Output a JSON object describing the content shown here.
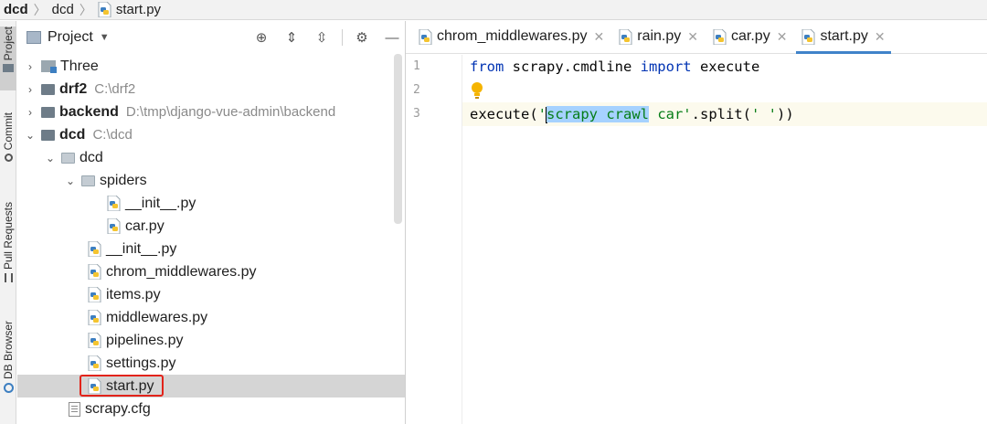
{
  "breadcrumb": {
    "items": [
      "dcd",
      "dcd",
      "start.py"
    ]
  },
  "toolstrip": {
    "tabs": [
      "Project",
      "Commit",
      "Pull Requests",
      "DB Browser"
    ]
  },
  "project_panel": {
    "title": "Project",
    "tree": [
      {
        "label": "Three",
        "path": ""
      },
      {
        "label": "drf2",
        "path": "C:\\drf2"
      },
      {
        "label": "backend",
        "path": "D:\\tmp\\django-vue-admin\\backend"
      },
      {
        "label": "dcd",
        "path": "C:\\dcd"
      },
      {
        "label": "dcd",
        "path": ""
      },
      {
        "label": "spiders",
        "path": ""
      },
      {
        "label": "__init__.py",
        "path": ""
      },
      {
        "label": "car.py",
        "path": ""
      },
      {
        "label": "__init__.py",
        "path": ""
      },
      {
        "label": "chrom_middlewares.py",
        "path": ""
      },
      {
        "label": "items.py",
        "path": ""
      },
      {
        "label": "middlewares.py",
        "path": ""
      },
      {
        "label": "pipelines.py",
        "path": ""
      },
      {
        "label": "settings.py",
        "path": ""
      },
      {
        "label": "start.py",
        "path": ""
      },
      {
        "label": "scrapy.cfg",
        "path": ""
      }
    ]
  },
  "editor": {
    "tabs": [
      "chrom_middlewares.py",
      "rain.py",
      "car.py",
      "start.py"
    ],
    "active_tab": "start.py",
    "line_numbers": [
      "1",
      "2",
      "3"
    ],
    "code": {
      "line1": {
        "kw1": "from",
        "mod": " scrapy.cmdline ",
        "kw2": "import",
        "name": " execute"
      },
      "line3": {
        "fn": "execute(",
        "q1": "'",
        "selected": "scrapy crawl",
        "rest_str": " car'",
        "mid": ".split(",
        "arg": "' '",
        "end": "))"
      }
    }
  },
  "colors": {
    "keyword": "#0033b3",
    "string": "#067d17",
    "selection": "#a6d2ff",
    "active_tab_underline": "#4083c9",
    "highlight_box": "#e2231a"
  }
}
